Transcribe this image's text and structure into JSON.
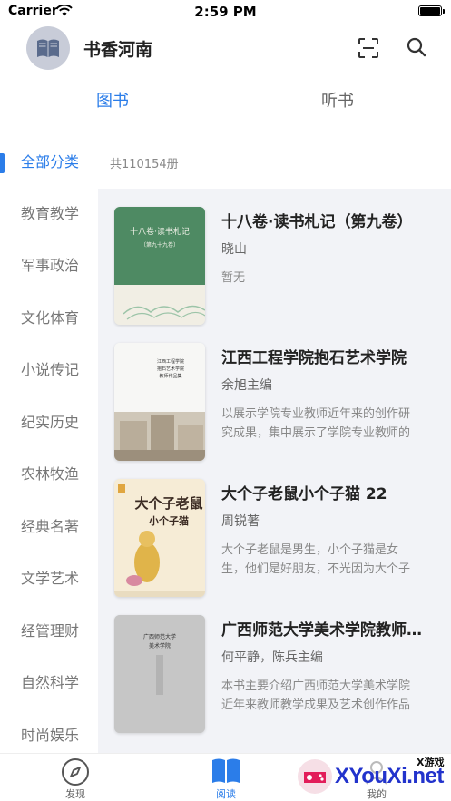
{
  "status_bar": {
    "carrier": "Carrier",
    "time": "2:59 PM"
  },
  "header": {
    "title": "书香河南",
    "avatar_icon": "book-icon",
    "scan_icon": "scan-icon",
    "search_icon": "search-icon"
  },
  "tabs": [
    {
      "label": "图书",
      "active": true
    },
    {
      "label": "听书",
      "active": false
    }
  ],
  "sidebar": {
    "items": [
      {
        "label": "全部分类",
        "active": true
      },
      {
        "label": "教育教学"
      },
      {
        "label": "军事政治"
      },
      {
        "label": "文化体育"
      },
      {
        "label": "小说传记"
      },
      {
        "label": "纪实历史"
      },
      {
        "label": "农林牧渔"
      },
      {
        "label": "经典名著"
      },
      {
        "label": "文学艺术"
      },
      {
        "label": "经管理财"
      },
      {
        "label": "自然科学"
      },
      {
        "label": "时尚娱乐"
      }
    ]
  },
  "count": "共110154册",
  "books": [
    {
      "title": "十八卷·读书札记（第九卷）",
      "author": "晓山",
      "desc_lines": [
        "暂无"
      ],
      "cover_text": [
        "十八卷·读书札记",
        "〔第九十九卷〕"
      ]
    },
    {
      "title": "江西工程学院抱石艺术学院",
      "author": "余旭主编",
      "desc_lines": [
        "以展示学院专业教师近年来的创作研",
        "究成果，集中展示了学院专业教师的"
      ],
      "cover_text": [
        "江西工程学院",
        "抱石艺术学院",
        "教师作品集"
      ]
    },
    {
      "title": "大个子老鼠小个子猫 22",
      "author": "周锐著",
      "desc_lines": [
        "大个子老鼠是男生，小个子猫是女",
        "生，他们是好朋友，不光因为大个子"
      ],
      "cover_text": [
        "大个子老鼠",
        "小个子猫"
      ]
    },
    {
      "title": "广西师范大学美术学院教师作品集",
      "author": "何平静，陈兵主编",
      "desc_lines": [
        "本书主要介绍广西师范大学美术学院",
        "近年来教师教学成果及艺术创作作品"
      ],
      "cover_text": [
        "广西师范大学",
        "美术学院"
      ]
    }
  ],
  "bottom_nav": [
    {
      "label": "发现",
      "icon": "compass-icon",
      "active": false
    },
    {
      "label": "阅读",
      "icon": "book-open-icon",
      "active": true
    },
    {
      "label": "我的",
      "icon": "user-icon",
      "active": false
    }
  ],
  "watermark": {
    "small": "X游戏",
    "big": "XYouXi.net"
  },
  "colors": {
    "accent": "#2b7de9",
    "panel_bg": "#f2f3f7",
    "text_main": "#222222",
    "text_muted": "#888888"
  }
}
